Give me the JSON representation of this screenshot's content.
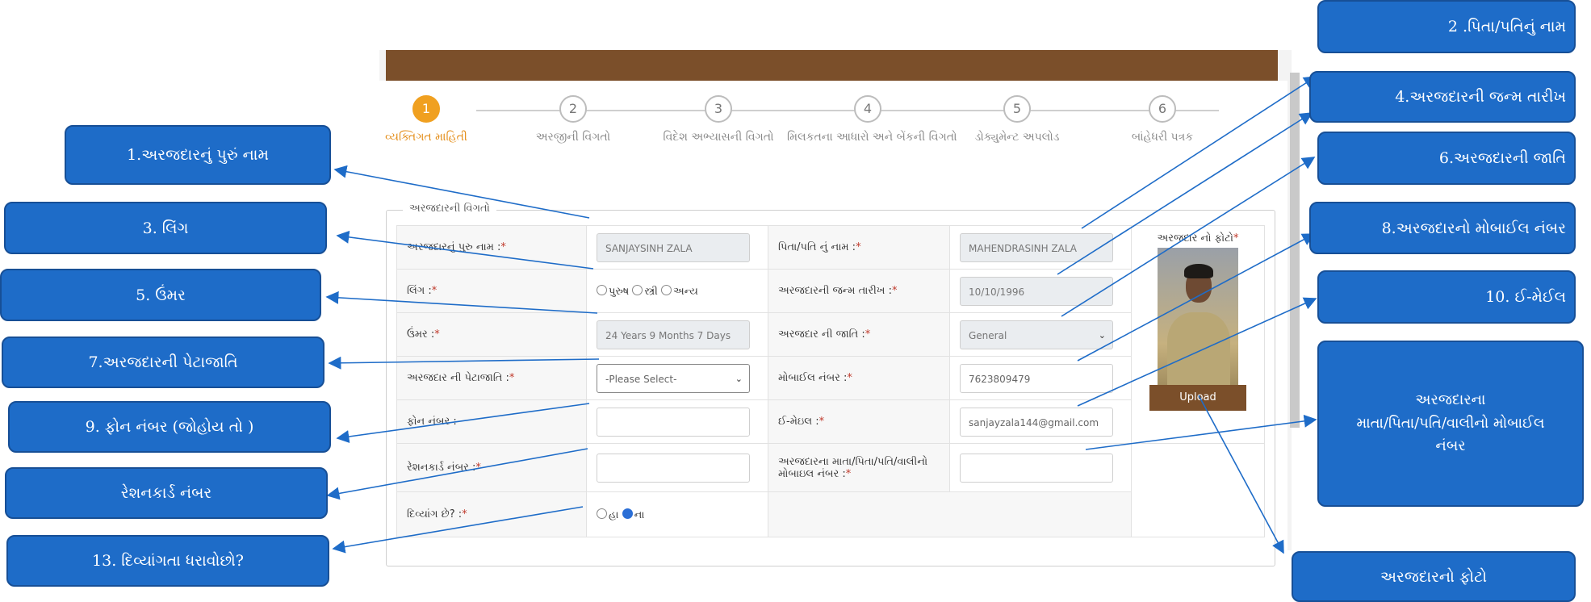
{
  "steps": [
    {
      "num": "1",
      "label": "વ્યક્તિગત માહિતી"
    },
    {
      "num": "2",
      "label": "અરજીની વિગતો"
    },
    {
      "num": "3",
      "label": "વિદેશ અભ્યાસની વિગતો"
    },
    {
      "num": "4",
      "label": "મિલકતના આધારો અને બેંકની વિગતો"
    },
    {
      "num": "5",
      "label": "ડોક્યુમેન્ટ અપલોડ"
    },
    {
      "num": "6",
      "label": "બાંહેધરી પત્રક"
    }
  ],
  "section_title": "અરજદારની વિગતો",
  "form": {
    "full_name_label": "અરજદારનું પુરુ નામ :",
    "full_name_value": "SANJAYSINH ZALA",
    "father_label": "પિતા/પતિ નું નામ :",
    "father_value": "MAHENDRASINH ZALA",
    "gender_label": "લિંગ :",
    "gender_options": [
      "પુરુષ",
      "સ્ત્રી",
      "અન્ય"
    ],
    "dob_label": "અરજદારની જન્મ તારીખ :",
    "dob_value": "10/10/1996",
    "age_label": "ઉંમર :",
    "age_value": "24 Years 9 Months 7 Days",
    "caste_label": "અરજદાર ની જાતિ :",
    "caste_value": "General",
    "subcaste_label": "અરજદાર ની પેટાજાતિ :",
    "subcaste_value": "-Please Select-",
    "mobile_label": "મોબાઈલ નંબર :",
    "mobile_value": "7623809479",
    "phone_label": "ફોન નંબર :",
    "email_label": "ઈ-મેઇલ :",
    "email_value": "sanjayzala144@gmail.com",
    "ration_label": "રેશનકાર્ડ નંબર :",
    "parent_mobile_label_1": "અરજદારના માતા/પિતા/પતિ/વાલીનો",
    "parent_mobile_label_2": "મોબાઇલ નંબર :",
    "disability_label": "દિવ્યાંગ છે? :",
    "disability_options": [
      "હા",
      "ના"
    ],
    "photo_label": "અરજદાર નો ફોટો",
    "upload_label": "Upload",
    "required_mark": "*"
  },
  "callouts": {
    "c1": "1.અરજદારનું પુરું નામ",
    "c3": "3. લિંગ",
    "c5": "5. ઉંમર",
    "c7": "7.અરજદારની પેટાજાતિ",
    "c9": "9. ફોન નંબર (જોહોય તો )",
    "cr": "રેશનકાર્ડ નંબર",
    "c13": "13. દિવ્યાંગતા ધરાવોછો?",
    "c2": "2 .પિતા/પતિનું  નામ",
    "c4": "4.અરજદારની જન્મ તારીખ",
    "c6": "6.અરજદારની જાતિ",
    "c8": "8.અરજદારનો મોબાઈલ નંબર",
    "c10": "10. ઈ-મેઈલ",
    "cp_1": "અરજદારના",
    "cp_2": "માતા/પિતા/પતિ/વાલીનો મોબાઈલ",
    "cp_3": "નંબર",
    "cph": "અરજદારનો ફોટો"
  },
  "colors": {
    "accent": "#1e6cc8",
    "brown": "#7b4f2a",
    "orange": "#f0a020"
  }
}
